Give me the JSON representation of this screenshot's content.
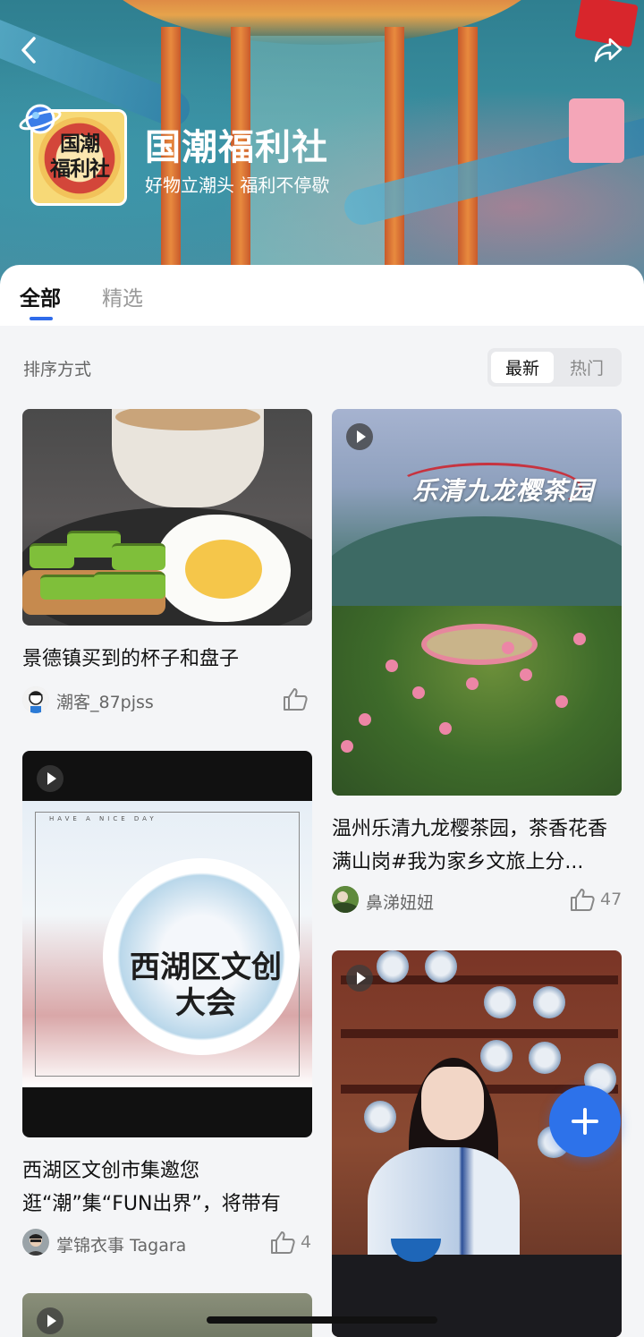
{
  "header": {
    "club_name": "国潮福利社",
    "slogan": "好物立潮头 福利不停歇",
    "logo_text": "国潮福利社",
    "back_icon": "chevron-left-icon",
    "share_icon": "share-arrow-icon"
  },
  "tabs": [
    {
      "label": "全部",
      "active": true
    },
    {
      "label": "精选",
      "active": false
    }
  ],
  "sort": {
    "label": "排序方式",
    "options": [
      {
        "label": "最新",
        "selected": true
      },
      {
        "label": "热门",
        "selected": false
      }
    ]
  },
  "posts": [
    {
      "title": "景德镇买到的杯子和盘子",
      "author": "潮客_87pjss",
      "likes": "",
      "video": false
    },
    {
      "title": "温州乐清九龙樱茶园，茶香花香满山岗#我为家乡文旅上分...",
      "image_caption": "乐清九龙樱茶园",
      "author": "鼻涕妞妞",
      "likes": "47",
      "video": true
    },
    {
      "title": "西湖区文创市集邀您逛“潮”集“FUN出界”，将带有又“潮...",
      "image_caption": "西湖区文创大会",
      "image_small_caption": "HAVE A NICE DAY",
      "author": "掌锦衣事 Tagara",
      "likes": "4",
      "video": true
    },
    {
      "title": "",
      "author": "",
      "likes": "",
      "video": true
    }
  ],
  "fab": {
    "icon": "plus-icon"
  },
  "colors": {
    "accent": "#2d72ea",
    "tab_underline": "#2f6bea"
  }
}
